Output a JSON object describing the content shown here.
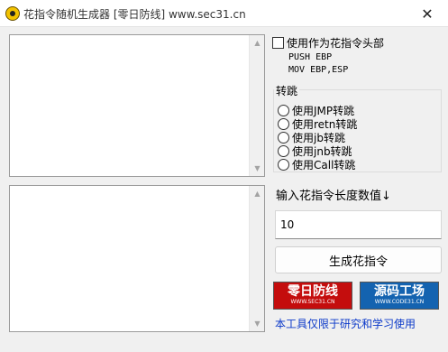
{
  "window": {
    "title": "花指令随机生成器  [零日防线]  www.sec31.cn",
    "close_glyph": "✕"
  },
  "header_option": {
    "label": "使用作为花指令头部",
    "code_lines": [
      "PUSH EBP",
      "MOV EBP,ESP"
    ]
  },
  "jump_group": {
    "title": "转跳",
    "options": [
      "使用JMP转跳",
      "使用retn转跳",
      "使用jb转跳",
      "使用jnb转跳",
      "使用Call转跳"
    ]
  },
  "length": {
    "label": "输入花指令长度数值↓",
    "value": "10"
  },
  "generate_button": "生成花指令",
  "banners": {
    "left": {
      "title": "零日防线",
      "url": "WWW.SEC31.CN"
    },
    "right": {
      "title": "源码工场",
      "url": "WWW.CODE31.CN"
    }
  },
  "footer": "本工具仅限于研究和学习使用"
}
